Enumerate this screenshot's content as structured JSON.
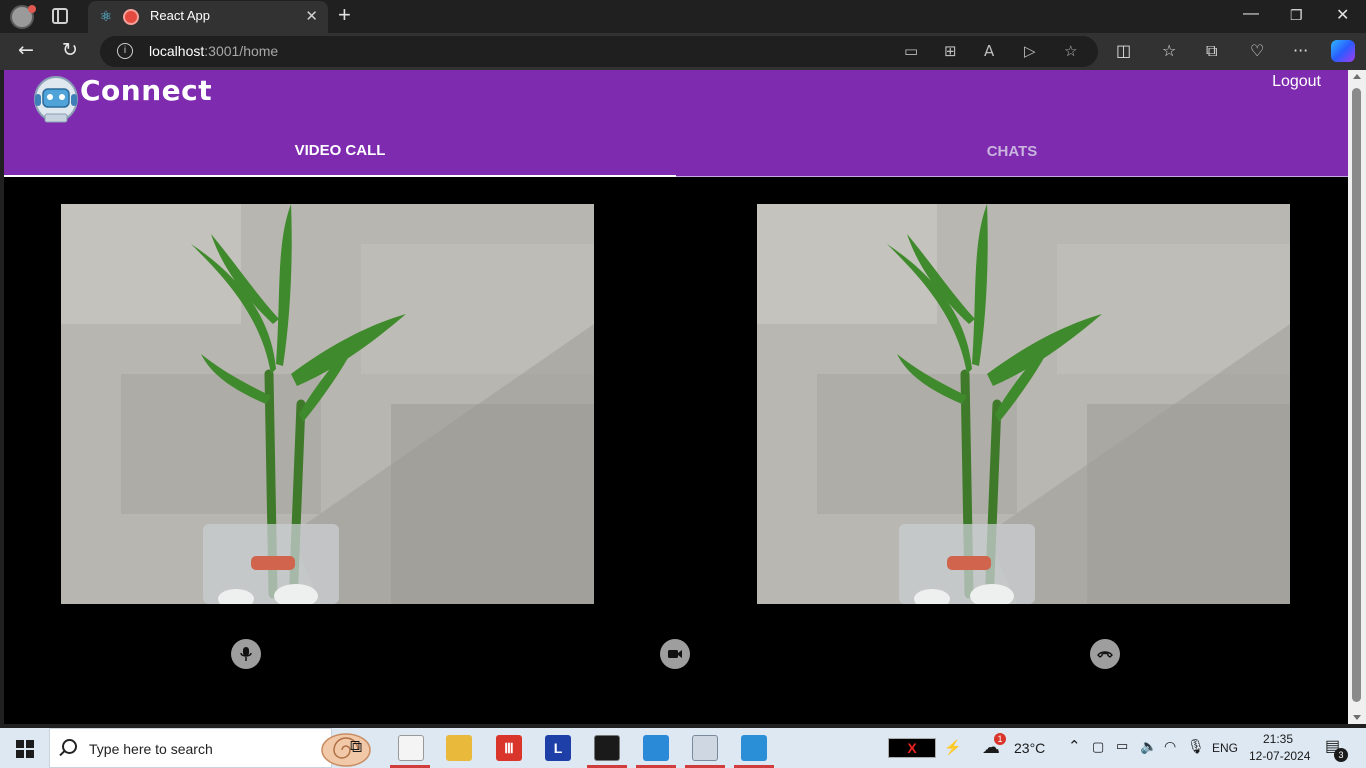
{
  "browser": {
    "tab_title": "React App",
    "url_host": "localhost",
    "url_path": ":3001/home"
  },
  "app": {
    "brand": "Connect",
    "logout_label": "Logout",
    "tabs": [
      {
        "label": "VIDEO CALL",
        "active": true
      },
      {
        "label": "CHATS",
        "active": false
      }
    ],
    "controls": {
      "mic": "mic-icon",
      "camera": "videocam-icon",
      "end_call": "call-end-icon"
    },
    "colors": {
      "appbar": "#7e2bb0",
      "background": "#000000",
      "control_button": "#9e9e9e"
    }
  },
  "taskbar": {
    "search_placeholder": "Type here to search",
    "weather_temp": "23°C",
    "weather_badge": "1",
    "language": "ENG",
    "time": "21:35",
    "date": "12-07-2024",
    "notifications": "3",
    "xbox_label": "X",
    "app_l_label": "L"
  }
}
